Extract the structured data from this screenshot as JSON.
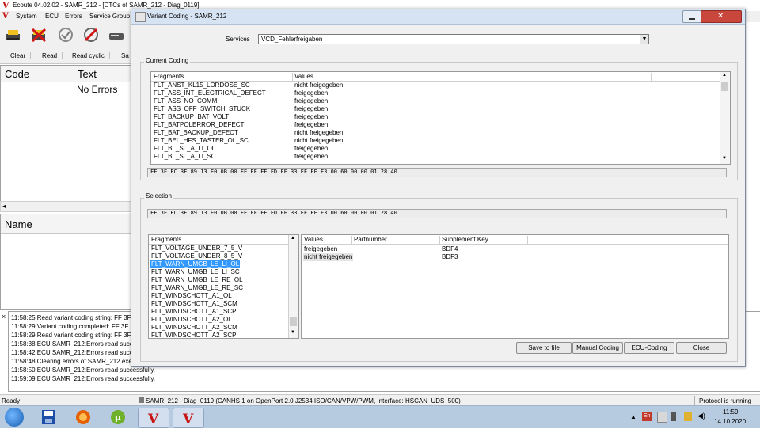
{
  "main": {
    "title": "Ecoute 04.02.02 - SAMR_212 - [DTCs of SAMR_212 - Diag_0119]",
    "menu": [
      "System",
      "ECU",
      "Errors",
      "Service Group"
    ],
    "subtoolbar": [
      "Clear",
      "Read",
      "Read cyclic",
      "Sa"
    ],
    "errors_grid": {
      "col_code": "Code",
      "col_text": "Text",
      "empty_text": "No Errors"
    },
    "detail_grid": {
      "col_name": "Name"
    },
    "log": [
      "11:58:25 Read variant coding string: FF 3F",
      "11:58:29 Variant coding completed: FF 3F",
      "11:58:29 Read variant coding string: FF 3F",
      "11:58:38 ECU SAMR_212:Errors read succes",
      "11:58:42 ECU SAMR_212:Errors read succes",
      "11:58:48 Clearing errors of SAMR_212 exe",
      "11:58:50 ECU SAMR_212:Errors read successfully.",
      "11:59:09 ECU SAMR_212:Errors read successfully."
    ],
    "status": {
      "left": "Ready",
      "middle": "SAMR_212 - Diag_0119 (CANHS 1 on OpenPort 2.0 J2534 ISO/CAN/VPW/PWM, Interface: HSCAN_UDS_500)",
      "right": "Protocol is running"
    }
  },
  "dialog": {
    "title": "Variant Coding - SAMR_212",
    "services_label": "Services",
    "services_value": "VCD_Fehlerfreigaben",
    "current_coding": {
      "group_label": "Current Coding",
      "col_fragments": "Fragments",
      "col_values": "Values",
      "rows": [
        {
          "fragment": "FLT_ANST_KL15_LORDOSE_SC",
          "value": "nicht freigegeben"
        },
        {
          "fragment": "FLT_ASS_INT_ELECTRICAL_DEFECT",
          "value": "freigegeben"
        },
        {
          "fragment": "FLT_ASS_NO_COMM",
          "value": "freigegeben"
        },
        {
          "fragment": "FLT_ASS_OFF_SWITCH_STUCK",
          "value": "freigegeben"
        },
        {
          "fragment": "FLT_BACKUP_BAT_VOLT",
          "value": "freigegeben"
        },
        {
          "fragment": "FLT_BATPOLERROR_DEFECT",
          "value": "freigegeben"
        },
        {
          "fragment": "FLT_BAT_BACKUP_DEFECT",
          "value": "nicht freigegeben"
        },
        {
          "fragment": "FLT_BEL_HFS_TASTER_OL_SC",
          "value": "nicht freigegeben"
        },
        {
          "fragment": "FLT_BL_SL_A_LI_OL",
          "value": "freigegeben"
        },
        {
          "fragment": "FLT_BL_SL_A_LI_SC",
          "value": "freigegeben"
        }
      ],
      "hex": "FF 3F FC 3F 89 13 E0 0B 00 FE FF FF FD FF 33 FF FF F3 00 60 00 00 01 28 40"
    },
    "selection": {
      "group_label": "Selection",
      "hex": "FF 3F FC 3F 89 13 E0 0B 00 FE FF FF FD FF 33 FF FF F3 00 60 00 00 01 28 40",
      "col_fragments": "Fragments",
      "fragments": [
        "FLT_VOLTAGE_UNDER_7_5_V",
        "FLT_VOLTAGE_UNDER_8_5_V",
        "FLT_WARN_UMGB_LE_LI_OL",
        "FLT_WARN_UMGB_LE_LI_SC",
        "FLT_WARN_UMGB_LE_RE_OL",
        "FLT_WARN_UMGB_LE_RE_SC",
        "FLT_WINDSCHOTT_A1_OL",
        "FLT_WINDSCHOTT_A1_SCM",
        "FLT_WINDSCHOTT_A1_SCP",
        "FLT_WINDSCHOTT_A2_OL",
        "FLT_WINDSCHOTT_A2_SCM",
        "FLT_WINDSCHOTT_A2_SCP"
      ],
      "selected_index": 2,
      "col_values": "Values",
      "col_partnumber": "Partnumber",
      "col_supplement": "Supplement Key",
      "options": [
        {
          "value": "freigegeben",
          "partnumber": "",
          "supplement": "BDF4"
        },
        {
          "value": "nicht freigegeben",
          "partnumber": "",
          "supplement": "BDF3"
        }
      ]
    },
    "buttons": {
      "save": "Save to file",
      "manual": "Manual Coding",
      "ecu": "ECU-Coding",
      "close": "Close"
    }
  },
  "taskbar": {
    "time": "11:59",
    "date": "14.10.2020",
    "lang": "En"
  },
  "colors": {
    "selection": "#3399ff",
    "brand_red": "#c81414",
    "taskbar": "#b7cbe0"
  }
}
